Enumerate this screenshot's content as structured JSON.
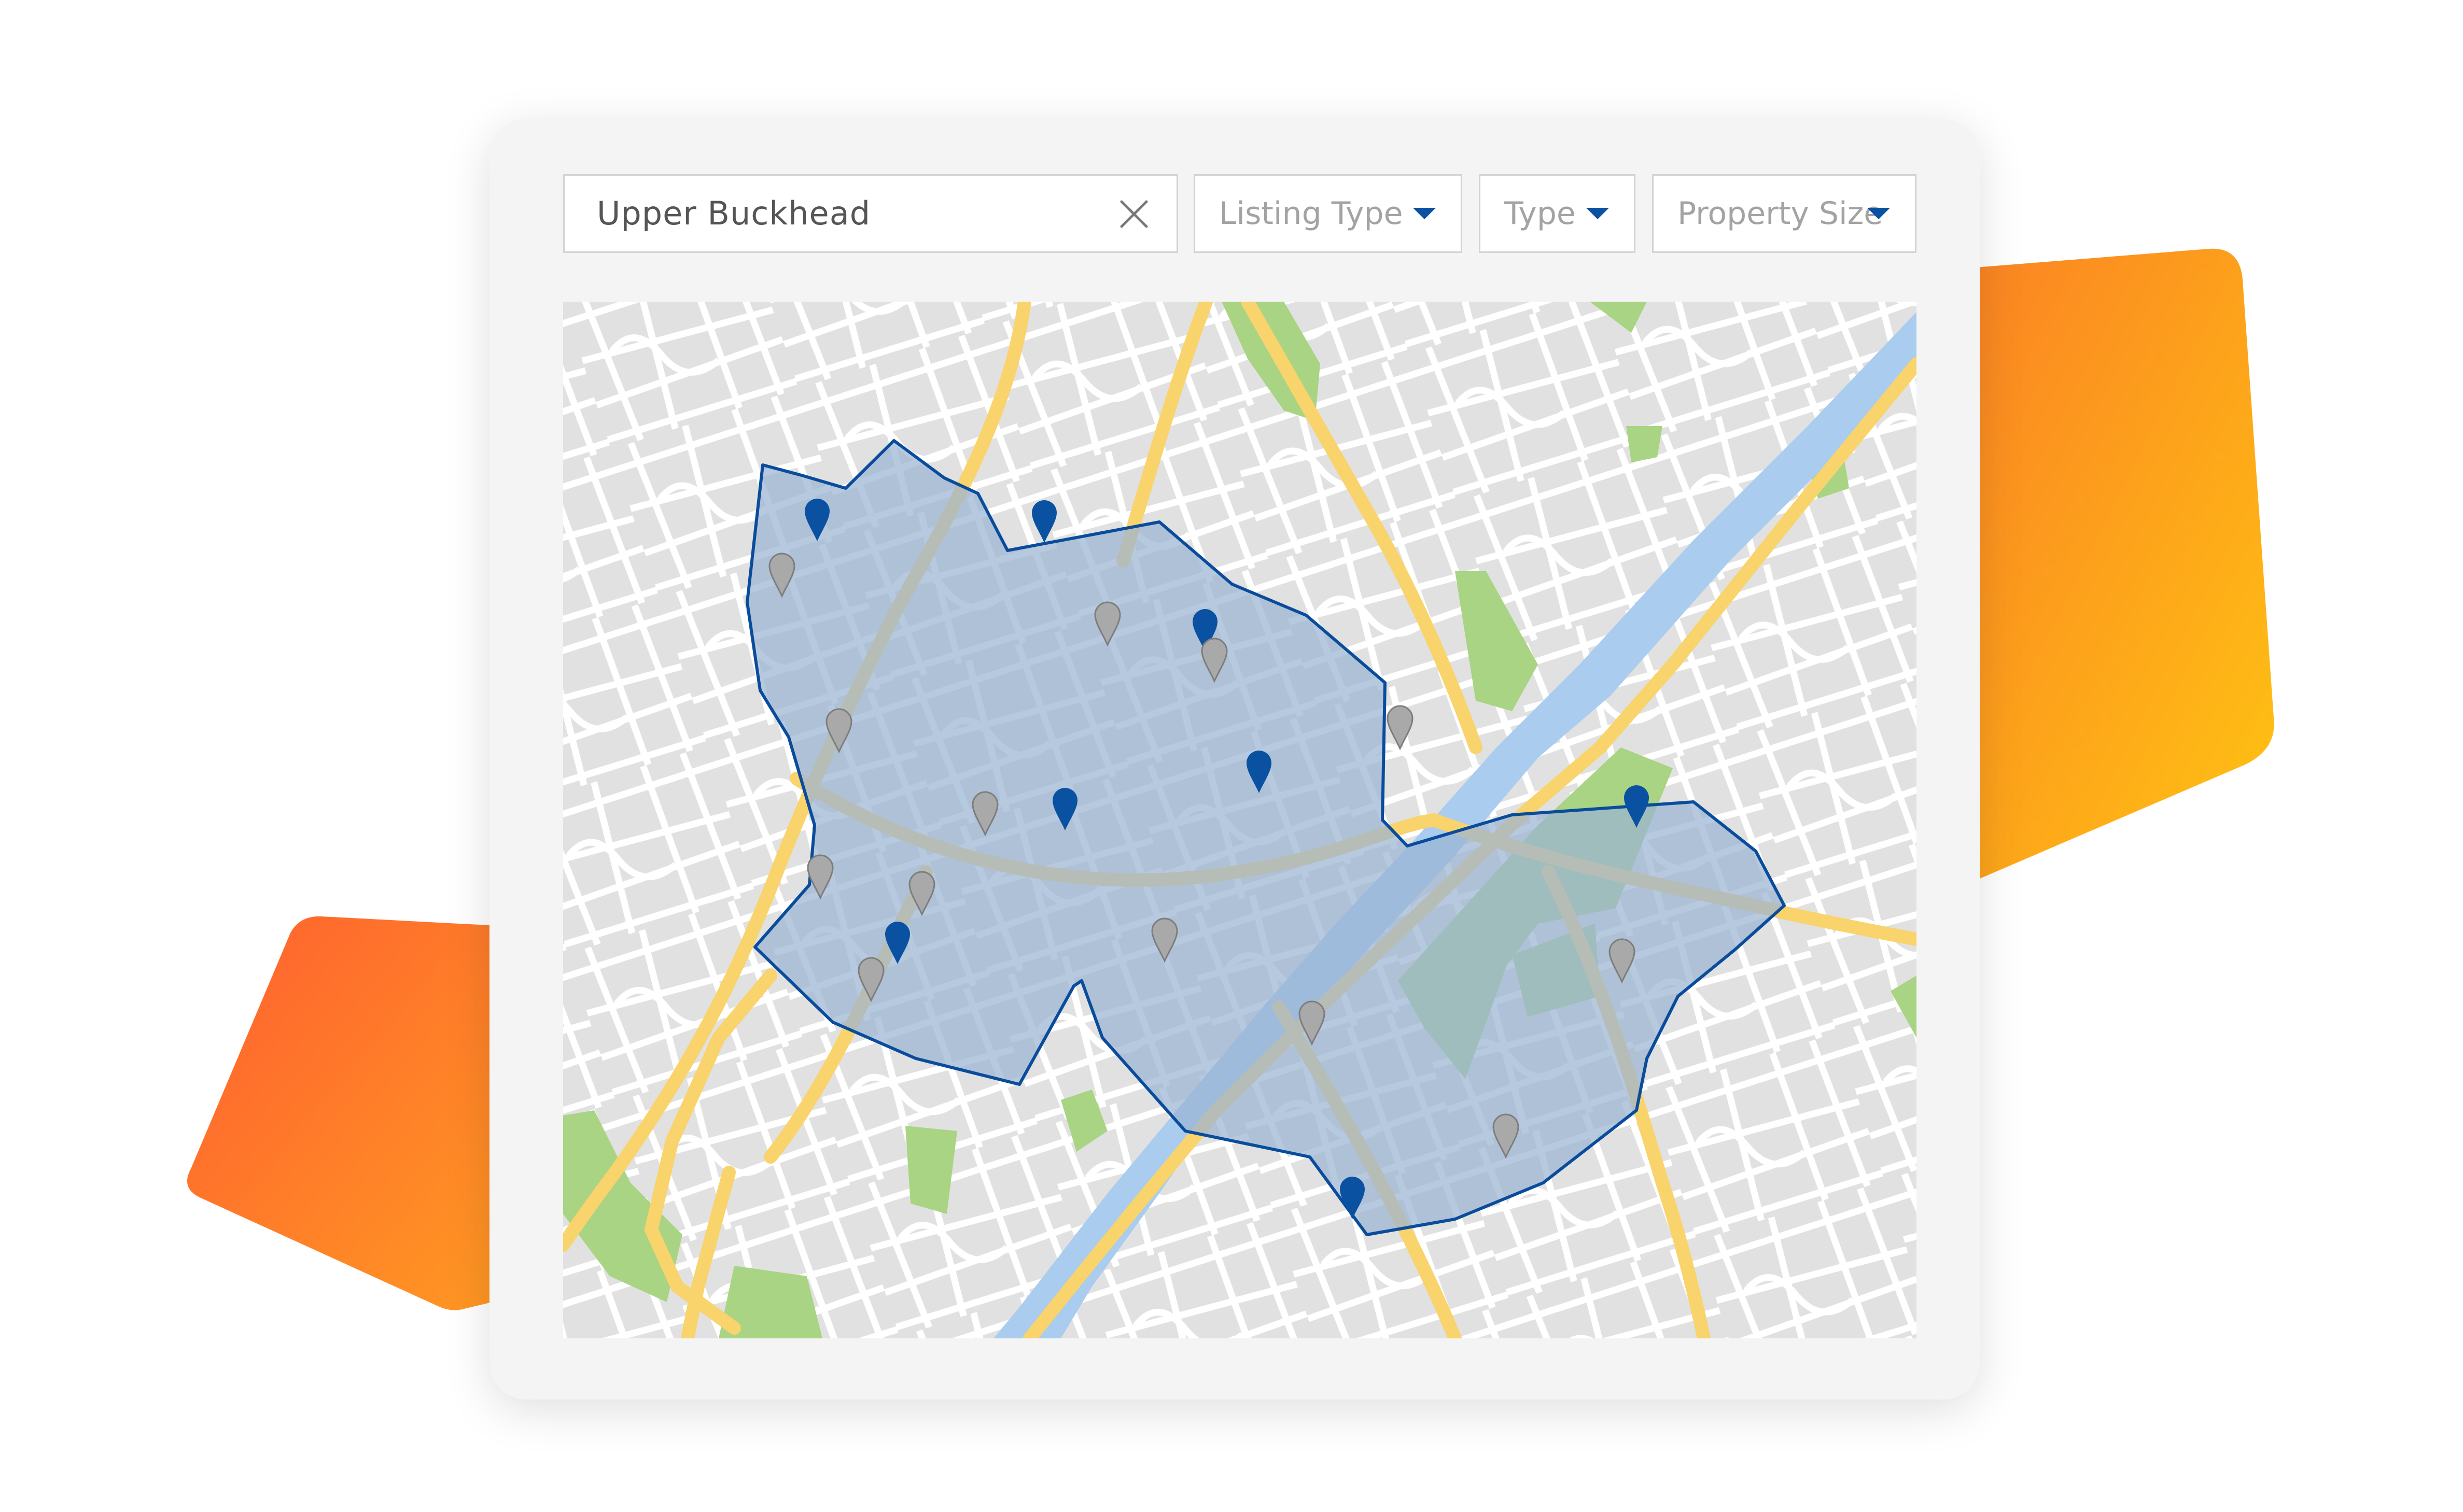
{
  "search": {
    "value": "Upper Buckhead",
    "clear_icon": "close-icon"
  },
  "filters": [
    {
      "label": "Listing Type",
      "icon": "caret-down-icon"
    },
    {
      "label": "Type",
      "icon": "caret-down-icon"
    },
    {
      "label": "Property Size",
      "icon": "caret-down-icon"
    }
  ],
  "map": {
    "pin_icon": "map-pin-icon",
    "colors": {
      "selected_pin": "#0a51a1",
      "pin": "#a9a9a9",
      "boundary": "#0a4c9c",
      "region_fill": "#9bb4d3",
      "major_road": "#f9d36b",
      "street": "#ffffff",
      "park": "#a8d483",
      "river": "#a9ccef",
      "land": "#e1e1e1"
    }
  },
  "decorations": {
    "colors": {
      "shape_start": "#ff6b2e",
      "shape_end": "#ffc20e"
    }
  }
}
